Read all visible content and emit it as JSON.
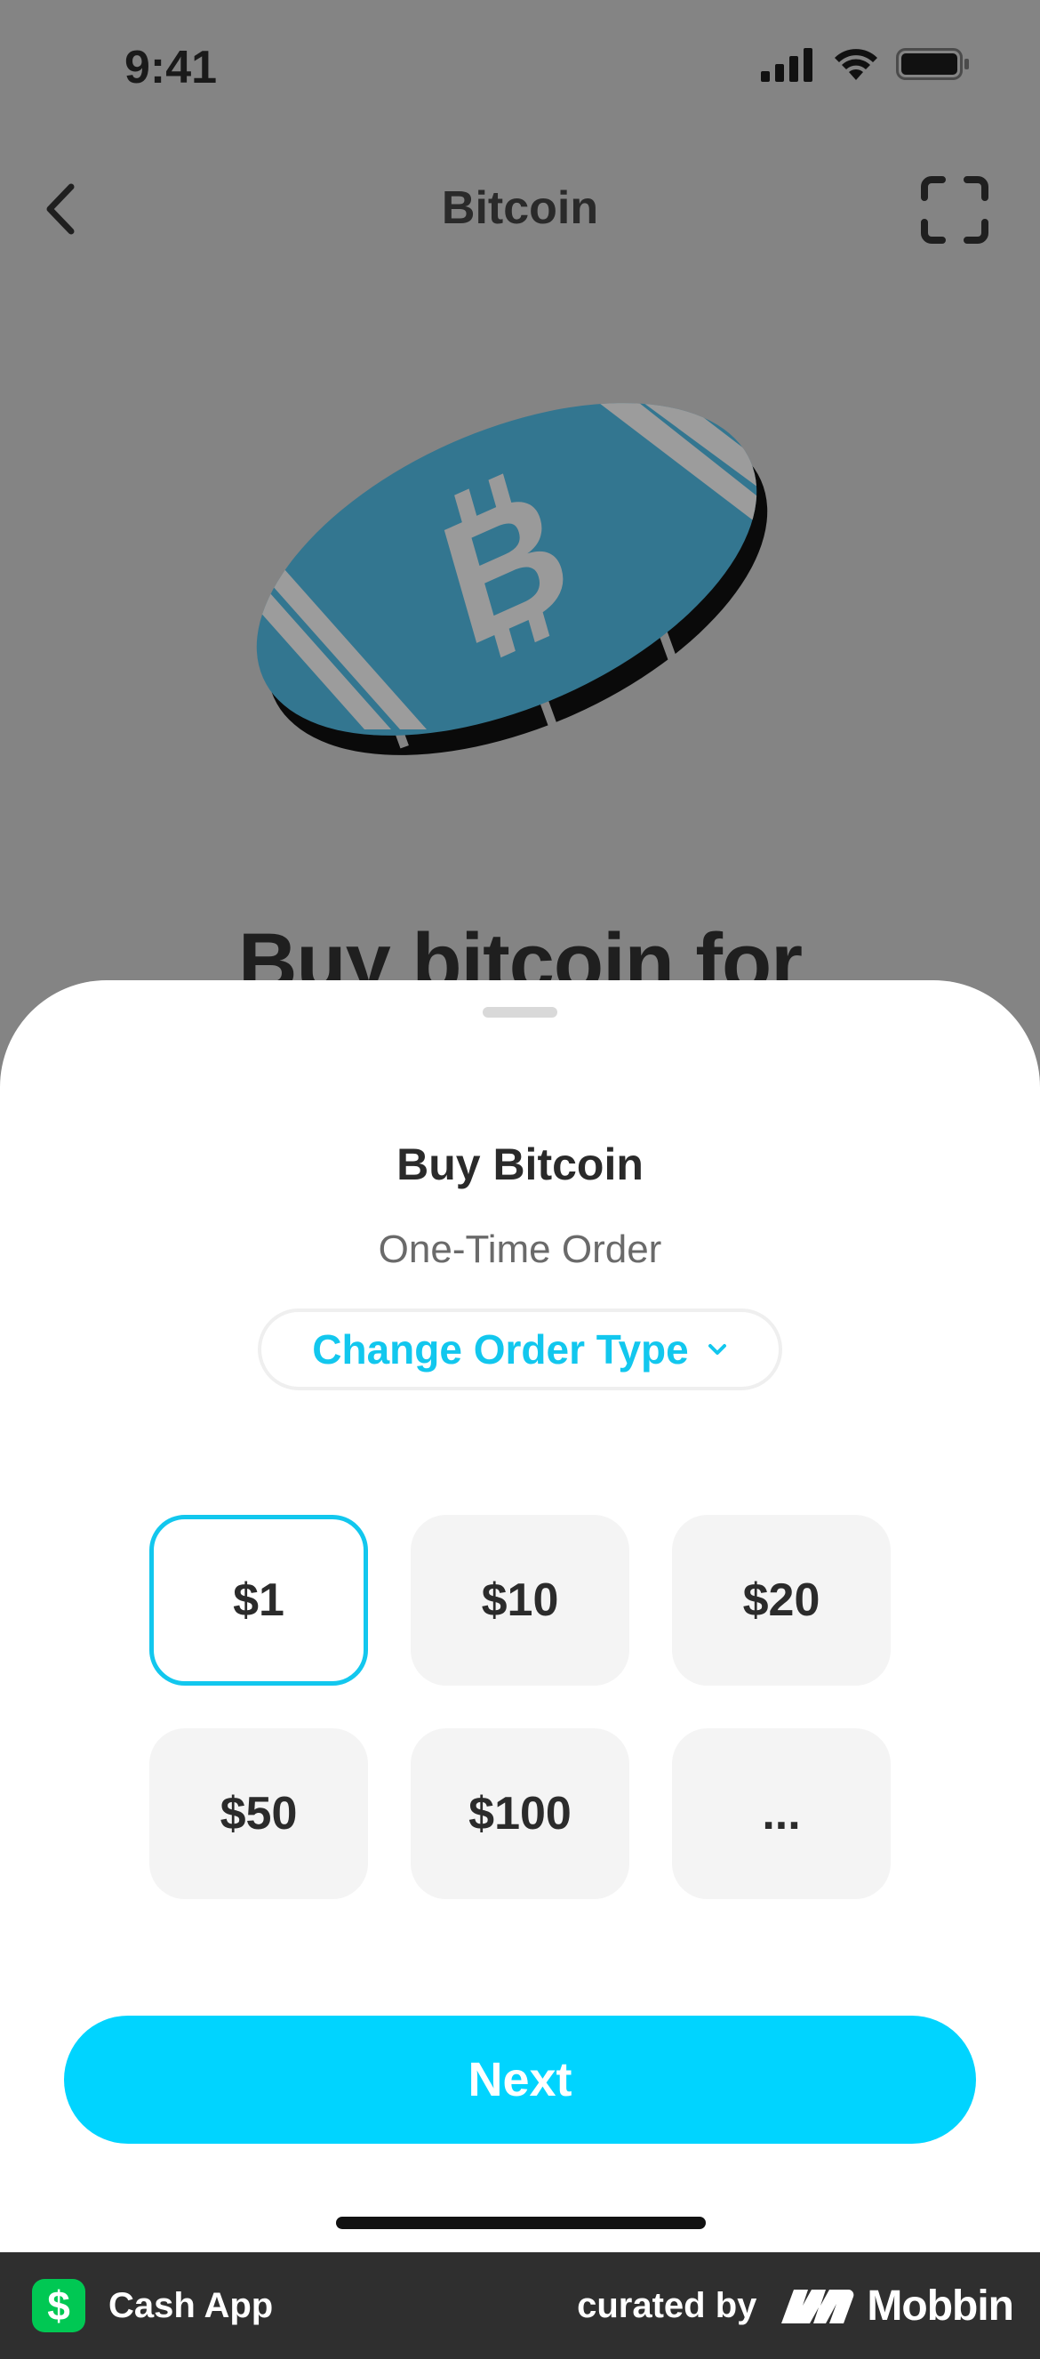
{
  "status_bar": {
    "time": "9:41"
  },
  "nav": {
    "title": "Bitcoin"
  },
  "hero": {
    "headline": "Buy bitcoin for"
  },
  "sheet": {
    "title": "Buy Bitcoin",
    "subtitle": "One-Time Order",
    "change_order_label": "Change Order Type",
    "amounts": [
      "$1",
      "$10",
      "$20",
      "$50",
      "$100",
      "..."
    ],
    "selected_amount": "$1",
    "next_label": "Next"
  },
  "footer": {
    "app_name": "Cash App",
    "app_icon_glyph": "$",
    "curated_by": "curated by",
    "brand": "Mobbin"
  },
  "colors": {
    "accent": "#00d4ff",
    "accent_text": "#12c7ee",
    "coin": "#337690",
    "overlay": "#848484",
    "cash_app_green": "#00c853"
  }
}
